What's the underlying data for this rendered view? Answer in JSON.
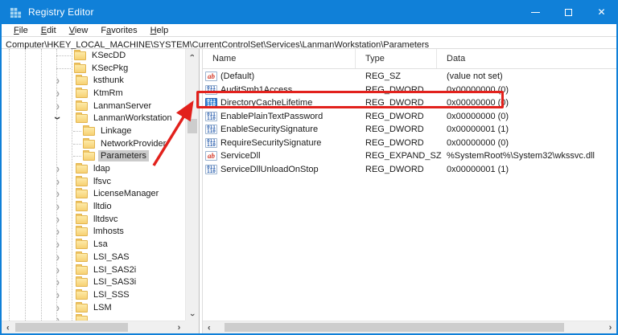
{
  "window": {
    "title": "Registry Editor",
    "accent": "#1080d8"
  },
  "icons": {
    "chevron": "›",
    "close": "✕",
    "string_label": "ab",
    "dword_top": "011",
    "dword_bottom": "110"
  },
  "menu": {
    "items": [
      {
        "pre": "",
        "key": "F",
        "post": "ile"
      },
      {
        "pre": "",
        "key": "E",
        "post": "dit"
      },
      {
        "pre": "",
        "key": "V",
        "post": "iew"
      },
      {
        "pre": "F",
        "key": "a",
        "post": "vorites"
      },
      {
        "pre": "",
        "key": "H",
        "post": "elp"
      }
    ]
  },
  "address": {
    "value": "Computer\\HKEY_LOCAL_MACHINE\\SYSTEM\\CurrentControlSet\\Services\\LanmanWorkstation\\Parameters"
  },
  "tree": {
    "items": [
      {
        "label": "KSecDD"
      },
      {
        "label": "KSecPkg"
      },
      {
        "label": "ksthunk"
      },
      {
        "label": "KtmRm"
      },
      {
        "label": "LanmanServer"
      },
      {
        "label": "LanmanWorkstation"
      },
      {
        "label": "Linkage"
      },
      {
        "label": "NetworkProvider"
      },
      {
        "label": "Parameters"
      },
      {
        "label": "ldap"
      },
      {
        "label": "lfsvc"
      },
      {
        "label": "LicenseManager"
      },
      {
        "label": "lltdio"
      },
      {
        "label": "lltdsvc"
      },
      {
        "label": "lmhosts"
      },
      {
        "label": "Lsa"
      },
      {
        "label": "LSI_SAS"
      },
      {
        "label": "LSI_SAS2i"
      },
      {
        "label": "LSI_SAS3i"
      },
      {
        "label": "LSI_SSS"
      },
      {
        "label": "LSM"
      },
      {
        "label": ""
      }
    ],
    "selected": "Parameters"
  },
  "list": {
    "columns": [
      "Name",
      "Type",
      "Data"
    ],
    "rows": [
      {
        "name": "(Default)",
        "type": "REG_SZ",
        "data": "(value not set)"
      },
      {
        "name": "AuditSmb1Access",
        "type": "REG_DWORD",
        "data": "0x00000000 (0)"
      },
      {
        "name": "DirectoryCacheLifetime",
        "type": "REG_DWORD",
        "data": "0x00000000 (0)"
      },
      {
        "name": "EnablePlainTextPassword",
        "type": "REG_DWORD",
        "data": "0x00000000 (0)"
      },
      {
        "name": "EnableSecuritySignature",
        "type": "REG_DWORD",
        "data": "0x00000001 (1)"
      },
      {
        "name": "RequireSecuritySignature",
        "type": "REG_DWORD",
        "data": "0x00000000 (0)"
      },
      {
        "name": "ServiceDll",
        "type": "REG_EXPAND_SZ",
        "data": "%SystemRoot%\\System32\\wkssvc.dll"
      },
      {
        "name": "ServiceDllUnloadOnStop",
        "type": "REG_DWORD",
        "data": "0x00000001 (1)"
      }
    ],
    "highlighted_row": "DirectoryCacheLifetime"
  },
  "annotation": {
    "color": "#e2211c"
  }
}
